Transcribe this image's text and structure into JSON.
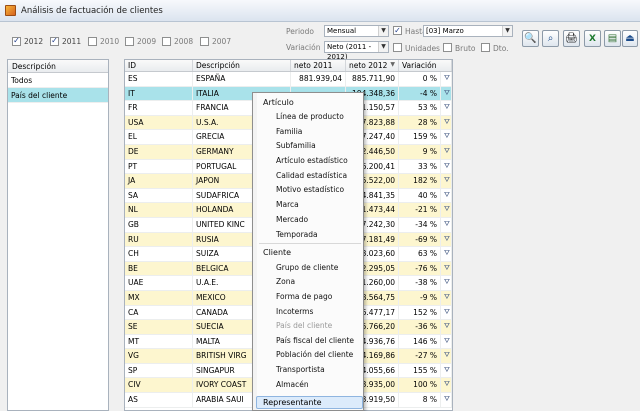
{
  "window": {
    "title": "Análisis de factuación de clientes"
  },
  "years": [
    {
      "label": "2012",
      "checked": true
    },
    {
      "label": "2011",
      "checked": true
    },
    {
      "label": "2010",
      "checked": false
    },
    {
      "label": "2009",
      "checked": false
    },
    {
      "label": "2008",
      "checked": false
    },
    {
      "label": "2007",
      "checked": false
    }
  ],
  "filters": {
    "periodo_label": "Periodo",
    "periodo_value": "Mensual",
    "hasta_label": "Hasta",
    "hasta_checked": true,
    "hasta_value": "[03] Marzo",
    "variacion_label": "Variación",
    "variacion_value": "Neto (2011 - 2012)",
    "unidades_label": "Unidades",
    "bruto_label": "Bruto",
    "dto_label": "Dto."
  },
  "toolbar_icons": [
    "search-icon",
    "zoom-icon",
    "print-icon",
    "excel-icon",
    "export-icon",
    "exit-icon"
  ],
  "left_panel": {
    "header": "Descripción",
    "items": [
      "Todos",
      "País del cliente"
    ]
  },
  "grid": {
    "columns": [
      "ID",
      "Descripción",
      "neto 2011",
      "neto 2012",
      "Variación"
    ],
    "sort_indicator": "▼",
    "rows": [
      {
        "id": "ES",
        "desc": "ESPAÑA",
        "n11": "881.939,04",
        "n12": "885.711,90",
        "var": "0 %"
      },
      {
        "id": "IT",
        "desc": "ITALIA",
        "n11": "",
        "n12": "194.348,36",
        "var": "-4 %"
      },
      {
        "id": "FR",
        "desc": "FRANCIA",
        "n11": "",
        "n12": "31.150,57",
        "var": "53 %"
      },
      {
        "id": "USA",
        "desc": "U.S.A.",
        "n11": "",
        "n12": "57.823,88",
        "var": "28 %"
      },
      {
        "id": "EL",
        "desc": "GRECIA",
        "n11": "",
        "n12": "57.247,40",
        "var": "159 %"
      },
      {
        "id": "DE",
        "desc": "GERMANY",
        "n11": "",
        "n12": "52.446,50",
        "var": "9 %"
      },
      {
        "id": "PT",
        "desc": "PORTUGAL",
        "n11": "",
        "n12": "36.200,41",
        "var": "33 %"
      },
      {
        "id": "JA",
        "desc": "JAPON",
        "n11": "",
        "n12": "25.522,00",
        "var": "182 %"
      },
      {
        "id": "SA",
        "desc": "SUDAFRICA",
        "n11": "",
        "n12": "24.841,35",
        "var": "40 %"
      },
      {
        "id": "NL",
        "desc": "HOLANDA",
        "n11": "",
        "n12": "21.473,44",
        "var": "-21 %"
      },
      {
        "id": "GB",
        "desc": "UNITED KINC",
        "n11": "",
        "n12": "17.242,30",
        "var": "-34 %"
      },
      {
        "id": "RU",
        "desc": "RUSIA",
        "n11": "",
        "n12": "17.181,49",
        "var": "-69 %"
      },
      {
        "id": "CH",
        "desc": "SUIZA",
        "n11": "",
        "n12": "13.023,60",
        "var": "63 %"
      },
      {
        "id": "BE",
        "desc": "BELGICA",
        "n11": "",
        "n12": "12.295,05",
        "var": "-76 %"
      },
      {
        "id": "UAE",
        "desc": "U.A.E.",
        "n11": "",
        "n12": "11.260,00",
        "var": "-38 %"
      },
      {
        "id": "MX",
        "desc": "MEXICO",
        "n11": "",
        "n12": "8.564,75",
        "var": "-9 %"
      },
      {
        "id": "CA",
        "desc": "CANADA",
        "n11": "",
        "n12": "6.477,17",
        "var": "152 %"
      },
      {
        "id": "SE",
        "desc": "SUECIA",
        "n11": "",
        "n12": "5.766,20",
        "var": "-36 %"
      },
      {
        "id": "MT",
        "desc": "MALTA",
        "n11": "",
        "n12": "4.936,76",
        "var": "146 %"
      },
      {
        "id": "VG",
        "desc": "BRITISH VIRG",
        "n11": "",
        "n12": "4.169,86",
        "var": "-27 %"
      },
      {
        "id": "SP",
        "desc": "SINGAPUR",
        "n11": "",
        "n12": "4.055,66",
        "var": "155 %"
      },
      {
        "id": "CIV",
        "desc": "IVORY COAST",
        "n11": "",
        "n12": "3.935,00",
        "var": "100 %"
      },
      {
        "id": "AS",
        "desc": "ARABIA SAUI",
        "n11": "",
        "n12": "3.919,50",
        "var": "8 %"
      }
    ]
  },
  "context_menu": {
    "section_articulo": "Artículo",
    "articulo_items": [
      "Línea de producto",
      "Familia",
      "Subfamilia",
      "Artículo estadístico",
      "Calidad estadística",
      "Motivo estadístico",
      "Marca",
      "Mercado",
      "Temporada"
    ],
    "section_cliente": "Cliente",
    "cliente_items": [
      "Grupo de cliente",
      "Zona",
      "Forma de pago",
      "Incoterms",
      "País del cliente",
      "País fiscal del cliente",
      "Población del cliente",
      "Transportista",
      "Almacén"
    ],
    "disabled_item": "País del cliente",
    "highlighted": "Representante"
  }
}
